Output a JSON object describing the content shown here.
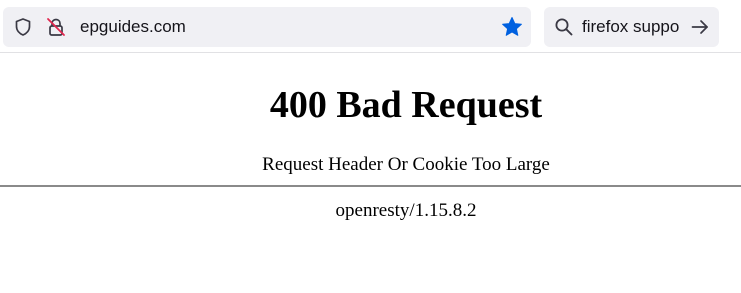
{
  "browser": {
    "url": "epguides.com",
    "search_query": "firefox suppo",
    "bookmark_star_color": "#0061e0",
    "icons": {
      "tracking_protection": "shield-icon",
      "connection_security": "lock-icon",
      "bookmark": "star-icon",
      "search": "search-icon",
      "go": "arrow-right-icon"
    }
  },
  "error_page": {
    "title": "400 Bad Request",
    "message": "Request Header Or Cookie Too Large",
    "server": "openresty/1.15.8.2"
  }
}
